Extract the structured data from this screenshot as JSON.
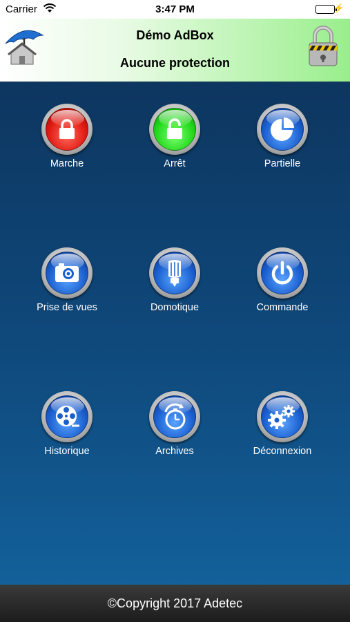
{
  "status_bar": {
    "carrier": "Carrier",
    "time": "3:47 PM"
  },
  "header": {
    "title": "Démo AdBox",
    "subtitle": "Aucune protection"
  },
  "tiles": [
    {
      "label": "Marche",
      "icon": "lock-closed-icon",
      "color": "#e01a12"
    },
    {
      "label": "Arrêt",
      "icon": "lock-open-icon",
      "color": "#22d91a"
    },
    {
      "label": "Partielle",
      "icon": "pie-chart-icon",
      "color": "#1a5fcf"
    },
    {
      "label": "Prise de vues",
      "icon": "camera-icon",
      "color": "#1a5fcf"
    },
    {
      "label": "Domotique",
      "icon": "light-bulb-icon",
      "color": "#1a5fcf"
    },
    {
      "label": "Commande",
      "icon": "power-icon",
      "color": "#1a5fcf"
    },
    {
      "label": "Historique",
      "icon": "film-reel-icon",
      "color": "#1a5fcf"
    },
    {
      "label": "Archives",
      "icon": "stopwatch-icon",
      "color": "#1a5fcf"
    },
    {
      "label": "Déconnexion",
      "icon": "gears-icon",
      "color": "#1a5fcf"
    }
  ],
  "footer": {
    "copyright": "©Copyright 2017 Adetec"
  }
}
